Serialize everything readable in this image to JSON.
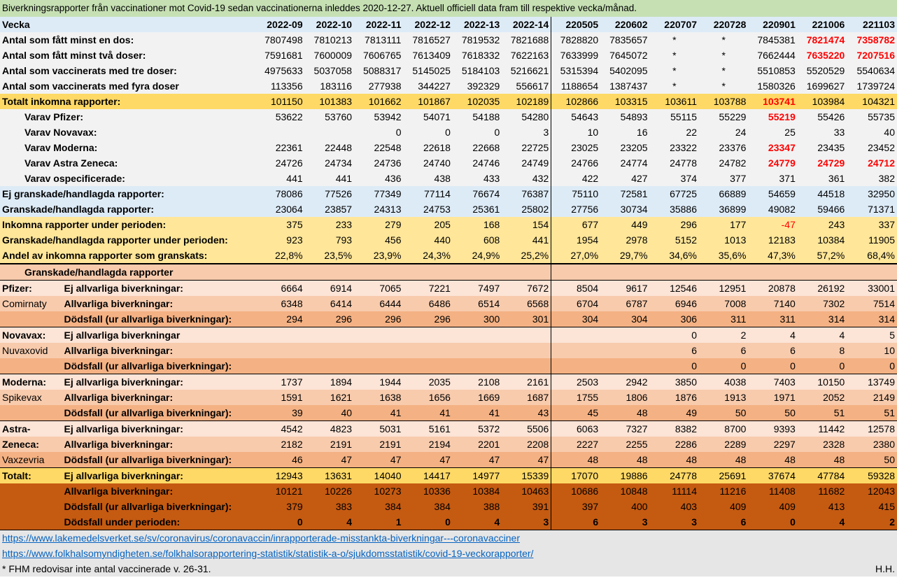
{
  "title": "Biverkningsrapporter från vaccinationer mot Covid-19 sedan vaccinationerna inleddes 2020-12-27. Aktuell officiell data fram till respektive vecka/månad.",
  "header": {
    "label": "Vecka",
    "cols": [
      "2022-09",
      "2022-10",
      "2022-11",
      "2022-12",
      "2022-13",
      "2022-14",
      "220505",
      "220602",
      "220707",
      "220728",
      "220901",
      "221006",
      "221103"
    ]
  },
  "rows": {
    "dos1": {
      "label": "Antal som fått minst en dos:",
      "values": [
        "7807498",
        "7810213",
        "7813111",
        "7816527",
        "7819532",
        "7821688",
        "7828820",
        "7835657",
        "*",
        "*",
        "7845381",
        "7821474",
        "7358782"
      ]
    },
    "dos2": {
      "label": "Antal som fått minst två doser:",
      "values": [
        "7591681",
        "7600009",
        "7606765",
        "7613409",
        "7618332",
        "7622163",
        "7633999",
        "7645072",
        "*",
        "*",
        "7662444",
        "7635220",
        "7207516"
      ]
    },
    "dos3": {
      "label": "Antal som vaccinerats med tre doser:",
      "values": [
        "4975633",
        "5037058",
        "5088317",
        "5145025",
        "5184103",
        "5216621",
        "5315394",
        "5402095",
        "*",
        "*",
        "5510853",
        "5520529",
        "5540634"
      ]
    },
    "dos4": {
      "label": "Antal som vaccinerats med fyra doser",
      "values": [
        "113356",
        "183116",
        "277938",
        "344227",
        "392329",
        "556617",
        "1188654",
        "1387437",
        "*",
        "*",
        "1580326",
        "1699627",
        "1739724"
      ]
    },
    "total": {
      "label": "Totalt inkomna rapporter:",
      "values": [
        "101150",
        "101383",
        "101662",
        "101867",
        "102035",
        "102189",
        "102866",
        "103315",
        "103611",
        "103788",
        "103741",
        "103984",
        "104321"
      ]
    },
    "pfizer": {
      "label": "Varav Pfizer:",
      "values": [
        "53622",
        "53760",
        "53942",
        "54071",
        "54188",
        "54280",
        "54643",
        "54893",
        "55115",
        "55229",
        "55219",
        "55426",
        "55735"
      ]
    },
    "novavax": {
      "label": "Varav Novavax:",
      "values": [
        "",
        "",
        "0",
        "0",
        "0",
        "3",
        "10",
        "16",
        "22",
        "24",
        "25",
        "33",
        "40"
      ]
    },
    "moderna": {
      "label": "Varav Moderna:",
      "values": [
        "22361",
        "22448",
        "22548",
        "22618",
        "22668",
        "22725",
        "23025",
        "23205",
        "23322",
        "23376",
        "23347",
        "23435",
        "23452"
      ]
    },
    "astra": {
      "label": "Varav Astra Zeneca:",
      "values": [
        "24726",
        "24734",
        "24736",
        "24740",
        "24746",
        "24749",
        "24766",
        "24774",
        "24778",
        "24782",
        "24779",
        "24729",
        "24712"
      ]
    },
    "unspec": {
      "label": "Varav ospecificerade:",
      "values": [
        "441",
        "441",
        "436",
        "438",
        "433",
        "432",
        "422",
        "427",
        "374",
        "377",
        "371",
        "361",
        "382"
      ]
    },
    "ejgr": {
      "label": "Ej granskade/handlagda rapporter:",
      "values": [
        "78086",
        "77526",
        "77349",
        "77114",
        "76674",
        "76387",
        "75110",
        "72581",
        "67725",
        "66889",
        "54659",
        "44518",
        "32950"
      ]
    },
    "gr": {
      "label": "Granskade/handlagda rapporter:",
      "values": [
        "23064",
        "23857",
        "24313",
        "24753",
        "25361",
        "25802",
        "27756",
        "30734",
        "35886",
        "36899",
        "49082",
        "59466",
        "71371"
      ]
    },
    "inkper": {
      "label": "Inkomna rapporter under perioden:",
      "values": [
        "375",
        "233",
        "279",
        "205",
        "168",
        "154",
        "677",
        "449",
        "296",
        "177",
        "-47",
        "243",
        "337"
      ]
    },
    "grper": {
      "label": "Granskade/handlagda rapporter under perioden:",
      "values": [
        "923",
        "793",
        "456",
        "440",
        "608",
        "441",
        "1954",
        "2978",
        "5152",
        "1013",
        "12183",
        "10384",
        "11905"
      ]
    },
    "andel": {
      "label": "Andel av inkomna rapporter som granskats:",
      "values": [
        "22,8%",
        "23,5%",
        "23,9%",
        "24,3%",
        "24,9%",
        "25,2%",
        "27,0%",
        "29,7%",
        "34,6%",
        "35,6%",
        "47,3%",
        "57,2%",
        "68,4%"
      ]
    }
  },
  "section_title": "Granskade/handlagda rapporter",
  "row_labels": {
    "ej": "Ej allvarliga biverkningar:",
    "allv": "Allvarliga biverkningar:",
    "dod": "Dödsfall (ur allvarliga biverkningar):",
    "ej_nocolon": "Ej allvarliga biverkningar"
  },
  "vaccines": {
    "pfizer": {
      "name": "Pfizer:",
      "sub": "Comirnaty",
      "ej": [
        "6664",
        "6914",
        "7065",
        "7221",
        "7497",
        "7672",
        "8504",
        "9617",
        "12546",
        "12951",
        "20878",
        "26192",
        "33001"
      ],
      "allv": [
        "6348",
        "6414",
        "6444",
        "6486",
        "6514",
        "6568",
        "6704",
        "6787",
        "6946",
        "7008",
        "7140",
        "7302",
        "7514"
      ],
      "dod": [
        "294",
        "296",
        "296",
        "296",
        "300",
        "301",
        "304",
        "304",
        "306",
        "311",
        "311",
        "314",
        "314"
      ]
    },
    "novavax": {
      "name": "Novavax:",
      "sub": "Nuvaxovid",
      "ej": [
        "",
        "",
        "",
        "",
        "",
        "",
        "",
        "",
        "0",
        "2",
        "4",
        "4",
        "5"
      ],
      "allv": [
        "",
        "",
        "",
        "",
        "",
        "",
        "",
        "",
        "6",
        "6",
        "6",
        "8",
        "10"
      ],
      "dod": [
        "",
        "",
        "",
        "",
        "",
        "",
        "",
        "",
        "0",
        "0",
        "0",
        "0",
        "0"
      ]
    },
    "moderna": {
      "name": "Moderna:",
      "sub": "Spikevax",
      "ej": [
        "1737",
        "1894",
        "1944",
        "2035",
        "2108",
        "2161",
        "2503",
        "2942",
        "3850",
        "4038",
        "7403",
        "10150",
        "13749"
      ],
      "allv": [
        "1591",
        "1621",
        "1638",
        "1656",
        "1669",
        "1687",
        "1755",
        "1806",
        "1876",
        "1913",
        "1971",
        "2052",
        "2149"
      ],
      "dod": [
        "39",
        "40",
        "41",
        "41",
        "41",
        "43",
        "45",
        "48",
        "49",
        "50",
        "50",
        "51",
        "51"
      ]
    },
    "astra": {
      "name": "Astra-",
      "name2": "Zeneca:",
      "sub": "Vaxzevria",
      "ej": [
        "4542",
        "4823",
        "5031",
        "5161",
        "5372",
        "5506",
        "6063",
        "7327",
        "8382",
        "8700",
        "9393",
        "11442",
        "12578"
      ],
      "allv": [
        "2182",
        "2191",
        "2191",
        "2194",
        "2201",
        "2208",
        "2227",
        "2255",
        "2286",
        "2289",
        "2297",
        "2328",
        "2380"
      ],
      "dod": [
        "46",
        "47",
        "47",
        "47",
        "47",
        "47",
        "48",
        "48",
        "48",
        "48",
        "48",
        "48",
        "50"
      ]
    }
  },
  "totalt": {
    "name": "Totalt:",
    "ej": [
      "12943",
      "13631",
      "14040",
      "14417",
      "14977",
      "15339",
      "17070",
      "19886",
      "24778",
      "25691",
      "37674",
      "47784",
      "59328"
    ],
    "allv": [
      "10121",
      "10226",
      "10273",
      "10336",
      "10384",
      "10463",
      "10686",
      "10848",
      "11114",
      "11216",
      "11408",
      "11682",
      "12043"
    ],
    "dod": [
      "379",
      "383",
      "384",
      "384",
      "388",
      "391",
      "397",
      "400",
      "403",
      "409",
      "409",
      "413",
      "415"
    ],
    "dodper_label": "Dödsfall under perioden:",
    "dodper": [
      "0",
      "4",
      "1",
      "0",
      "4",
      "3",
      "6",
      "3",
      "3",
      "6",
      "0",
      "4",
      "2"
    ]
  },
  "links": [
    "https://www.lakemedelsverket.se/sv/coronavirus/coronavaccin/inrapporterade-misstankta-biverkningar---coronavacciner",
    "https://www.folkhalsomyndigheten.se/folkhalsorapportering-statistik/statistik-a-o/sjukdomsstatistik/covid-19-veckorapporter/"
  ],
  "footnote": "* FHM redovisar inte antal vaccinerade v. 26-31.",
  "signature": "H.H."
}
